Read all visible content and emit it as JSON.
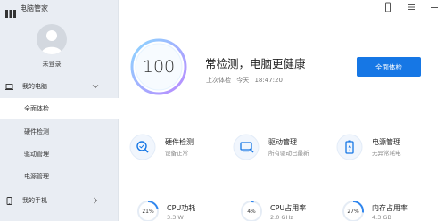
{
  "app": {
    "title": "电脑管家",
    "logo_icon": "huawei-logo-icon"
  },
  "user": {
    "login_label": "未登录",
    "avatar_icon": "user-avatar-icon"
  },
  "sidebar": {
    "group_computer": {
      "label": "我的电脑",
      "icon": "laptop-icon"
    },
    "items": [
      {
        "label": "全面体检",
        "active": true
      },
      {
        "label": "硬件检测",
        "active": false
      },
      {
        "label": "驱动管理",
        "active": false
      },
      {
        "label": "电源管理",
        "active": false
      }
    ],
    "group_phone": {
      "label": "我的手机",
      "icon": "phone-icon"
    }
  },
  "window": {
    "controls": [
      "phone-icon",
      "menu-icon",
      "minimize-icon"
    ]
  },
  "summary": {
    "score": "100",
    "headline": "常检测，电脑更健康",
    "last_check_label": "上次体检",
    "last_check_day": "今天",
    "last_check_time": "18:47:20",
    "button": "全面体检"
  },
  "tools": [
    {
      "title": "硬件检测",
      "subtitle": "设备正常",
      "icon": "hardware-scan-icon"
    },
    {
      "title": "驱动管理",
      "subtitle": "所有驱动已最新",
      "icon": "driver-icon"
    },
    {
      "title": "电源管理",
      "subtitle": "无异常耗电",
      "icon": "power-icon"
    }
  ],
  "metrics": [
    {
      "title": "CPU功耗",
      "value_text": "3.3 W",
      "gauge": "21%",
      "percent": 21
    },
    {
      "title": "CPU占用率",
      "value_text": "2.0 GHz",
      "gauge": "4%",
      "percent": 4
    },
    {
      "title": "内存占用率",
      "value_text": "4.3 GB",
      "gauge": "27%",
      "percent": 27
    }
  ],
  "colors": {
    "accent": "#1677e5",
    "sidebar_bg": "#e9edf3",
    "ring_start": "#7fd3ff",
    "ring_end": "#b27cff"
  }
}
